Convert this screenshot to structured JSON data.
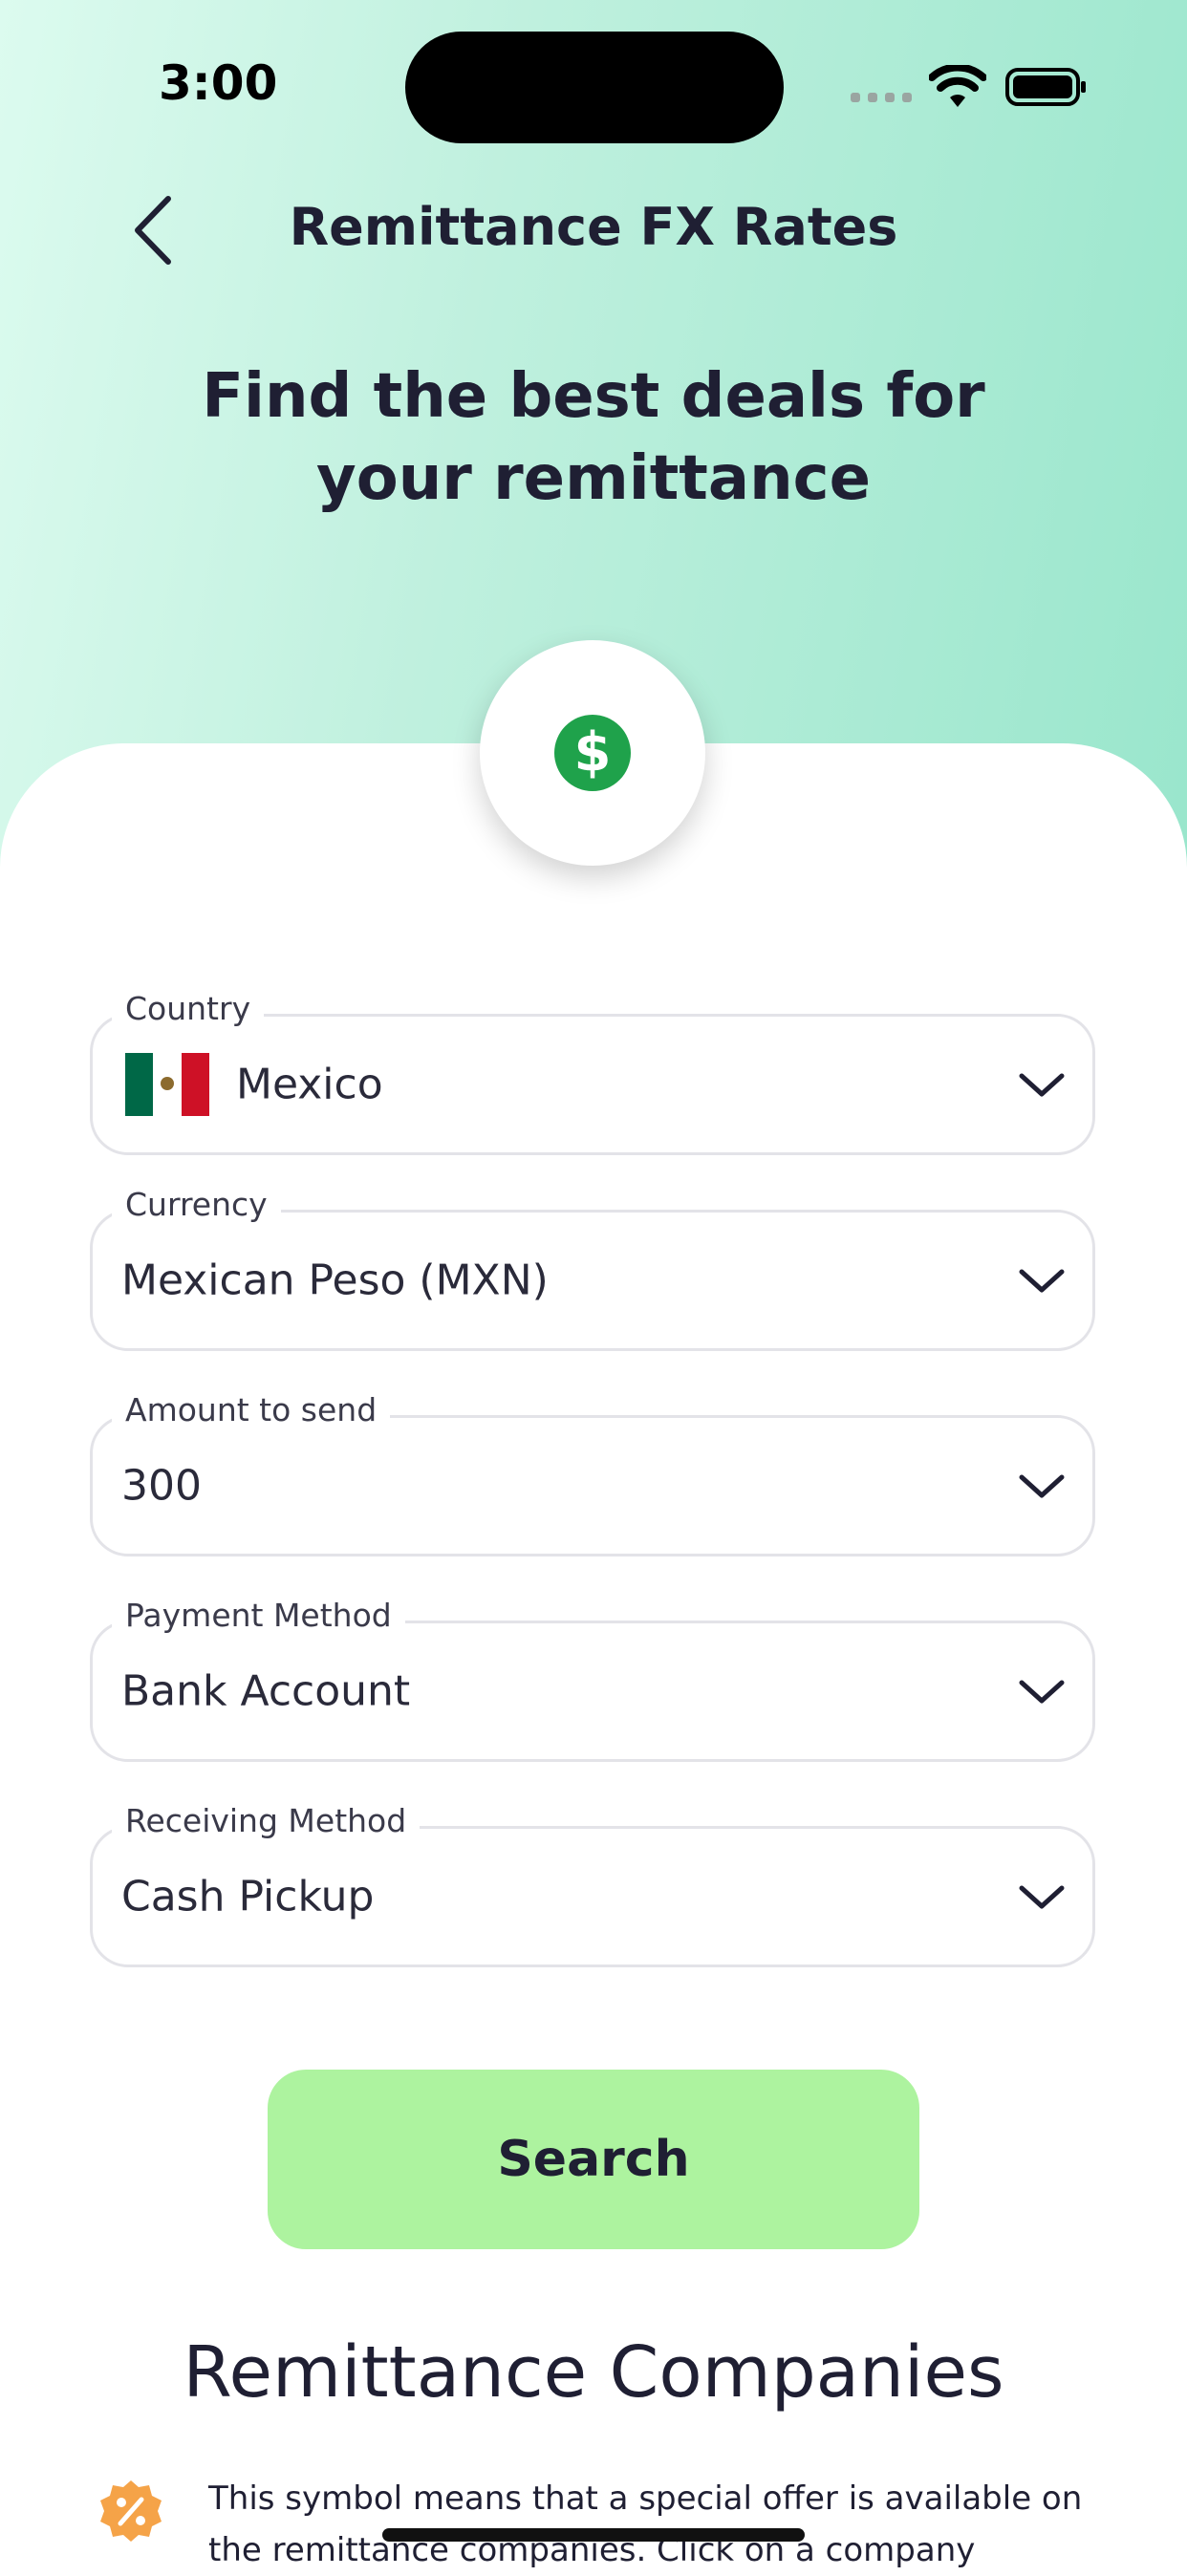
{
  "status_bar": {
    "time": "3:00"
  },
  "nav": {
    "title": "Remittance FX Rates"
  },
  "headline": "Find the best deals for your remittance",
  "badge": {
    "icon": "dollar-coin-icon",
    "symbol": "$",
    "color": "#1fa24b"
  },
  "form": {
    "country": {
      "label": "Country",
      "value": "Mexico",
      "flag": "mexico-flag-icon"
    },
    "currency": {
      "label": "Currency",
      "value": "Mexican Peso (MXN)"
    },
    "amount": {
      "label": "Amount to send",
      "value": "300"
    },
    "payment_method": {
      "label": "Payment Method",
      "value": "Bank Account"
    },
    "receiving_method": {
      "label": "Receiving Method",
      "value": "Cash Pickup"
    }
  },
  "search_button": {
    "label": "Search",
    "color": "#adf39f"
  },
  "companies": {
    "title": "Remittance Companies",
    "offer_icon": "special-offer-percent-icon",
    "offer_color": "#f5a348",
    "offer_note": "This symbol means that a special offer is available on the remittance companies. Click on a company"
  }
}
